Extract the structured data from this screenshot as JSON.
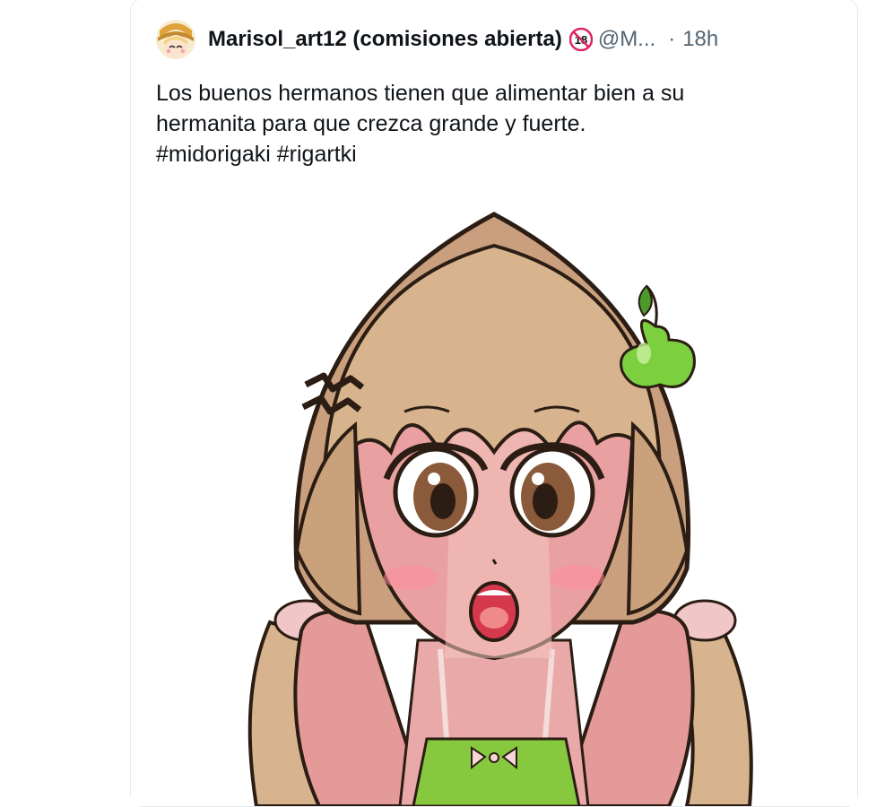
{
  "post": {
    "author_name": "Marisol_art12 (comisiones abierta)",
    "badge_icon": "adult-content-badge-icon",
    "badge_text": "18",
    "handle": "@M...",
    "separator": "·",
    "time": "18h",
    "text_lines": [
      "Los buenos hermanos tienen que alimentar bien a su",
      "hermanita para que crezca grande y fuerte.",
      "#midorigaki #rigartki"
    ],
    "media": {
      "icon": "anime-girl-illustration-icon"
    }
  },
  "colors": {
    "text_primary": "#0f1419",
    "text_secondary": "#536471",
    "border": "#e6e9ec",
    "hair": "#c9a27c",
    "skin": "#d98e8e",
    "apple": "#7ccf3f",
    "shirt": "#86c93f"
  }
}
